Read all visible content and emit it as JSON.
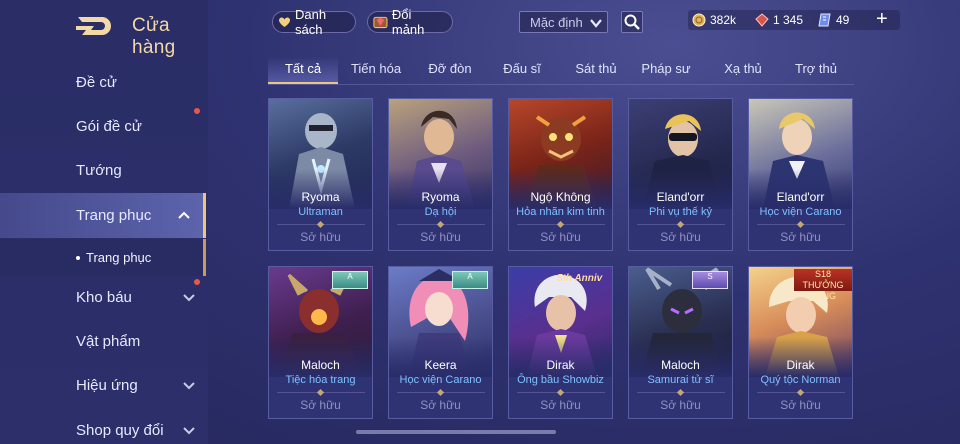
{
  "header": {
    "title": "Cửa hàng",
    "back_icon": "back-d-logo-icon",
    "wishlist_label": "Danh sách",
    "exchange_label": "Đổi mảnh",
    "sort_value": "Mặc định",
    "currencies": [
      {
        "icon": "gold-coin-icon",
        "value": "382k"
      },
      {
        "icon": "ruby-gem-icon",
        "value": "1 345"
      },
      {
        "icon": "voucher-icon",
        "value": "49"
      }
    ]
  },
  "sidebar": {
    "items": [
      {
        "label": "Đề cử"
      },
      {
        "label": "Gói đề cử"
      },
      {
        "label": "Tướng"
      },
      {
        "label": "Trang phục"
      },
      {
        "label": "Kho báu"
      },
      {
        "label": "Vật phẩm"
      },
      {
        "label": "Hiệu ứng"
      },
      {
        "label": "Shop quy đổi"
      }
    ],
    "subitem": "Trang phục"
  },
  "tabs": [
    "Tất cả",
    "Tiến hóa",
    "Đỡ đòn",
    "Đấu sĩ",
    "Sát thủ",
    "Pháp sư",
    "Xạ thủ",
    "Trợ thủ"
  ],
  "cards": [
    {
      "hero": "Ryoma",
      "skin": "Ultraman",
      "status": "Sở hữu"
    },
    {
      "hero": "Ryoma",
      "skin": "Dạ hội",
      "status": "Sở hữu"
    },
    {
      "hero": "Ngộ Không",
      "skin": "Hỏa nhãn kim tinh",
      "status": "Sở hữu"
    },
    {
      "hero": "Eland'orr",
      "skin": "Phi vụ thế kỷ",
      "status": "Sở hữu"
    },
    {
      "hero": "Eland'orr",
      "skin": "Học viện Carano",
      "status": "Sở hữu"
    },
    {
      "hero": "Maloch",
      "skin": "Tiệc hóa trang",
      "status": "Sở hữu",
      "badge": "A"
    },
    {
      "hero": "Keera",
      "skin": "Học viện Carano",
      "status": "Sở hữu",
      "badge": "A"
    },
    {
      "hero": "Dirak",
      "skin": "Ông bầu Showbiz",
      "status": "Sở hữu",
      "overlay": "5th Anniv"
    },
    {
      "hero": "Maloch",
      "skin": "Samurai tử sĩ",
      "status": "Sở hữu",
      "badge": "S"
    },
    {
      "hero": "Dirak",
      "skin": "Quý tộc Norman",
      "status": "Sở hữu",
      "event": "S18 THƯỞNG HẠNG"
    }
  ],
  "colors": {
    "accent_gold": "#e8c784",
    "skin_name": "#7fc0ff",
    "notification": "#e8574a"
  }
}
